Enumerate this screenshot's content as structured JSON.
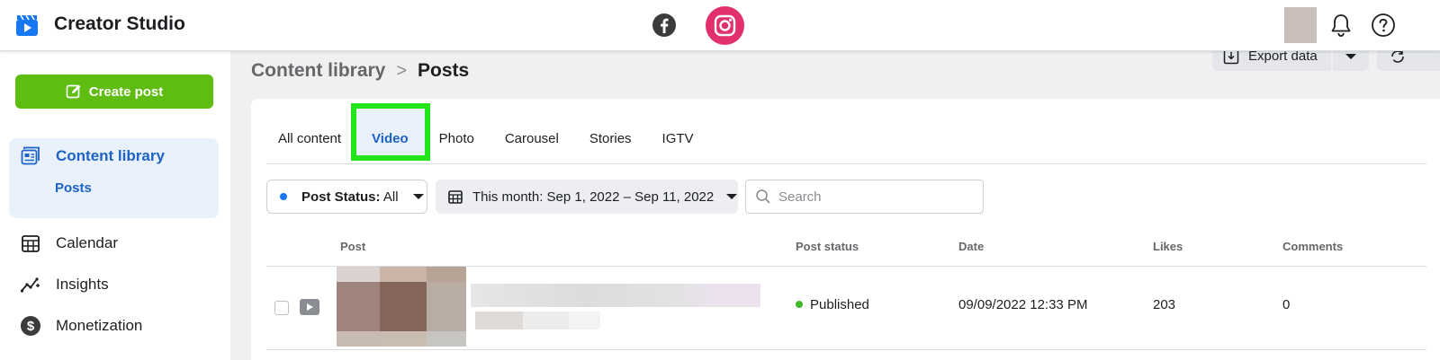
{
  "header": {
    "app_title": "Creator Studio",
    "logo_icon": "creator-studio-clapper-icon",
    "platforms": [
      {
        "name": "facebook",
        "icon": "facebook-icon",
        "active": false
      },
      {
        "name": "instagram",
        "icon": "instagram-icon",
        "active": true,
        "color": "#e1306c"
      }
    ],
    "right_icons": [
      "avatar",
      "bell-icon",
      "help-icon"
    ]
  },
  "sidebar": {
    "create_post_label": "Create post",
    "create_post_color": "#5fbc10",
    "items": [
      {
        "label": "Content library",
        "icon": "content-library-icon",
        "active": true,
        "sub": [
          "Posts"
        ]
      },
      {
        "label": "Calendar",
        "icon": "calendar-icon"
      },
      {
        "label": "Insights",
        "icon": "insights-icon"
      },
      {
        "label": "Monetization",
        "icon": "dollar-icon"
      }
    ]
  },
  "breadcrumb": {
    "parent": "Content library",
    "separator": ">",
    "current": "Posts"
  },
  "toolbar": {
    "export_label": "Export data"
  },
  "tabs": [
    {
      "label": "All content"
    },
    {
      "label": "Video",
      "active": true
    },
    {
      "label": "Photo"
    },
    {
      "label": "Carousel"
    },
    {
      "label": "Stories"
    },
    {
      "label": "IGTV"
    }
  ],
  "highlight_color": "#22e619",
  "filters": {
    "status_label": "Post Status:",
    "status_value": "All",
    "date_label": "This month: Sep 1, 2022 – Sep 11, 2022",
    "search_placeholder": "Search"
  },
  "table": {
    "columns": [
      "Post",
      "Post status",
      "Date",
      "Likes",
      "Comments"
    ],
    "rows": [
      {
        "type": "video",
        "status": "Published",
        "date": "09/09/2022 12:33 PM",
        "likes": "203",
        "comments": "0"
      }
    ]
  },
  "accent_color": "#1d62c5"
}
